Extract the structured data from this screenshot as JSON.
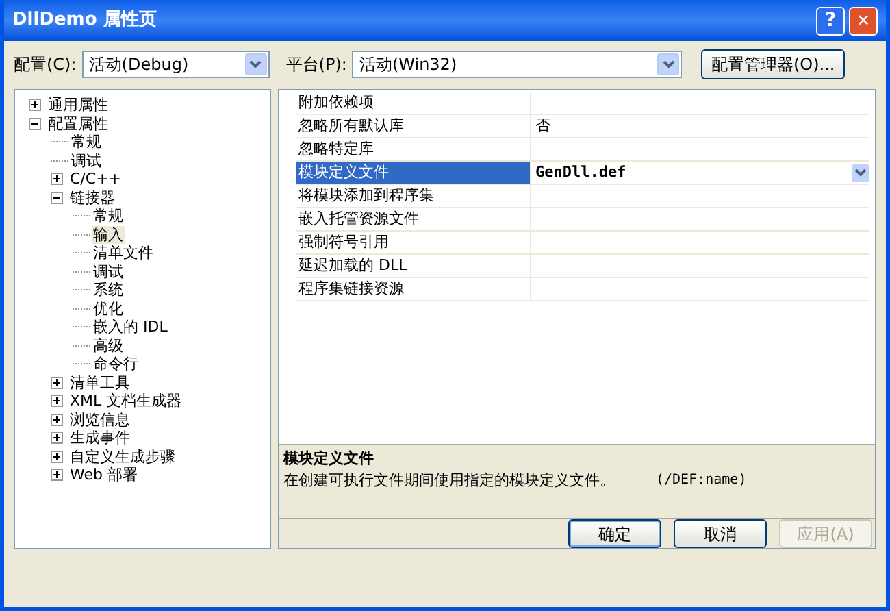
{
  "window": {
    "title": "DllDemo 属性页",
    "help": "?",
    "close": "✕"
  },
  "config": {
    "label": "配置(C):",
    "value": "活动(Debug)"
  },
  "platform": {
    "label": "平台(P):",
    "value": "活动(Win32)"
  },
  "config_manager_button": "配置管理器(O)...",
  "tree": [
    {
      "label": "通用属性",
      "expanded": false,
      "selected": false
    },
    {
      "label": "配置属性",
      "expanded": true,
      "selected": false,
      "children": [
        {
          "label": "常规",
          "selected": false
        },
        {
          "label": "调试",
          "selected": false
        },
        {
          "label": "C/C++",
          "expanded": false,
          "selected": false
        },
        {
          "label": "链接器",
          "expanded": true,
          "selected": false,
          "children": [
            {
              "label": "常规",
              "selected": false
            },
            {
              "label": "输入",
              "selected": true
            },
            {
              "label": "清单文件",
              "selected": false
            },
            {
              "label": "调试",
              "selected": false
            },
            {
              "label": "系统",
              "selected": false
            },
            {
              "label": "优化",
              "selected": false
            },
            {
              "label": "嵌入的 IDL",
              "selected": false
            },
            {
              "label": "高级",
              "selected": false
            },
            {
              "label": "命令行",
              "selected": false
            }
          ]
        },
        {
          "label": "清单工具",
          "expanded": false,
          "selected": false
        },
        {
          "label": "XML 文档生成器",
          "expanded": false,
          "selected": false
        },
        {
          "label": "浏览信息",
          "expanded": false,
          "selected": false
        },
        {
          "label": "生成事件",
          "expanded": false,
          "selected": false
        },
        {
          "label": "自定义生成步骤",
          "expanded": false,
          "selected": false
        },
        {
          "label": "Web 部署",
          "expanded": false,
          "selected": false
        }
      ]
    }
  ],
  "properties": [
    {
      "name": "附加依赖项",
      "selected": false
    },
    {
      "name": "忽略所有默认库",
      "value": "否",
      "selected": false
    },
    {
      "name": "忽略特定库",
      "selected": false
    },
    {
      "name": "模块定义文件",
      "value": "GenDll.def",
      "selected": true
    },
    {
      "name": "将模块添加到程序集",
      "selected": false
    },
    {
      "name": "嵌入托管资源文件",
      "selected": false
    },
    {
      "name": "强制符号引用",
      "selected": false
    },
    {
      "name": "延迟加载的 DLL",
      "selected": false
    },
    {
      "name": "程序集链接资源",
      "selected": false
    }
  ],
  "description": {
    "title": "模块定义文件",
    "text": "在创建可执行文件期间使用指定的模块定义文件。",
    "switch": "(/DEF:name)"
  },
  "buttons": [
    {
      "label": "确定",
      "disabled": false,
      "default": true
    },
    {
      "label": "取消",
      "disabled": false,
      "default": false
    },
    {
      "label": "应用(A)",
      "disabled": true,
      "default": false
    }
  ]
}
